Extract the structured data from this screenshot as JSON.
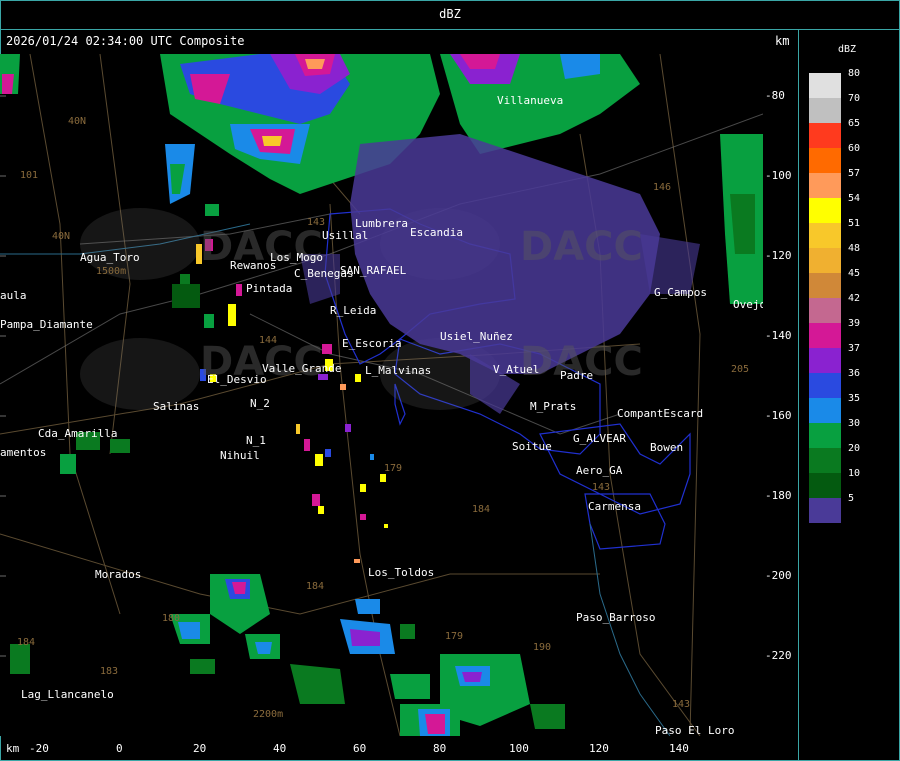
{
  "window": {
    "title": "dBZ"
  },
  "map": {
    "header": "2026/01/24 02:34:00 UTC Composite",
    "km_top": "km",
    "km_bottom": "km",
    "y_ticks": [
      "-80",
      "-100",
      "-120",
      "-140",
      "-160",
      "-180",
      "-200",
      "-220"
    ],
    "x_ticks": [
      "-20",
      "0",
      "20",
      "40",
      "60",
      "80",
      "100",
      "120",
      "140"
    ],
    "places": [
      {
        "name": "Villanueva"
      },
      {
        "name": "Usillal"
      },
      {
        "name": "Lumbrera"
      },
      {
        "name": "Escandia"
      },
      {
        "name": "C_Benegas"
      },
      {
        "name": "SAN_RAFAEL"
      },
      {
        "name": "R_Leida"
      },
      {
        "name": "Rewanos"
      },
      {
        "name": "Los_Mogo"
      },
      {
        "name": "Pintada"
      },
      {
        "name": "E_Escoria"
      },
      {
        "name": "L_Malvinas"
      },
      {
        "name": "El_Desvio"
      },
      {
        "name": "Valle_Grande"
      },
      {
        "name": "N_2"
      },
      {
        "name": "N_1"
      },
      {
        "name": "Nihuil"
      },
      {
        "name": "Salinas"
      },
      {
        "name": "Cda_Amarilla"
      },
      {
        "name": "Agua_Toro"
      },
      {
        "name": "Pampa_Diamante"
      },
      {
        "name": "Morados"
      },
      {
        "name": "Los_Toldos"
      },
      {
        "name": "V_Atuel"
      },
      {
        "name": "Padre"
      },
      {
        "name": "M_Prats"
      },
      {
        "name": "CompantEscard"
      },
      {
        "name": "G_ALVEAR"
      },
      {
        "name": "Bowen"
      },
      {
        "name": "Soitue"
      },
      {
        "name": "Aero_GA"
      },
      {
        "name": "Carmensa"
      },
      {
        "name": "G_Campos"
      },
      {
        "name": "Paso_Barroso"
      },
      {
        "name": "Lag_Llancanelo"
      },
      {
        "name": "Paso_El_Loro"
      },
      {
        "name": "Usiel_Nuñez"
      },
      {
        "name": "Ovejo"
      },
      {
        "name": "amentos"
      },
      {
        "name": "aula"
      }
    ],
    "route_labels": [
      "40N",
      "101",
      "40N",
      "143",
      "144",
      "179",
      "184",
      "184",
      "179",
      "190",
      "143",
      "183",
      "184",
      "180",
      "146",
      "205",
      "143",
      "1500m",
      "2200m"
    ],
    "watermark": "DACC"
  },
  "legend": {
    "unit": "dBZ",
    "entries": [
      {
        "value": "80",
        "color": "#e0e0e0"
      },
      {
        "value": "70",
        "color": "#c0c0c0"
      },
      {
        "value": "65",
        "color": "#ff3a1e"
      },
      {
        "value": "60",
        "color": "#ff6a00"
      },
      {
        "value": "57",
        "color": "#ff9a5a"
      },
      {
        "value": "54",
        "color": "#ffff00"
      },
      {
        "value": "51",
        "color": "#f8c82a"
      },
      {
        "value": "48",
        "color": "#f0b030"
      },
      {
        "value": "45",
        "color": "#d08838"
      },
      {
        "value": "42",
        "color": "#c46890"
      },
      {
        "value": "39",
        "color": "#d41896"
      },
      {
        "value": "37",
        "color": "#8a22d0"
      },
      {
        "value": "36",
        "color": "#2a4ae0"
      },
      {
        "value": "35",
        "color": "#1a8ae8"
      },
      {
        "value": "30",
        "color": "#08a040"
      },
      {
        "value": "20",
        "color": "#0a7a20"
      },
      {
        "value": "10",
        "color": "#045a10"
      },
      {
        "value": "5",
        "color": "#4a3a98"
      }
    ]
  }
}
